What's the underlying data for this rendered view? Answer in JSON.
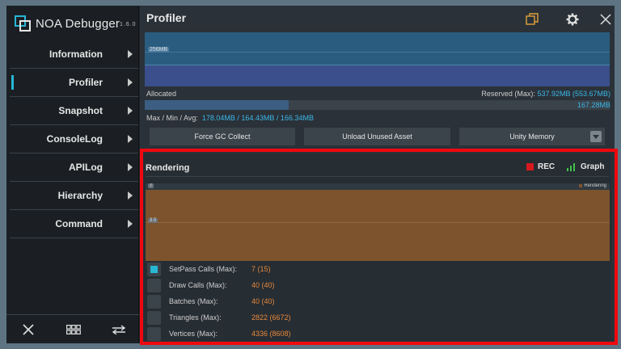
{
  "app": {
    "name": "NOA Debugger",
    "version": "1.6.0"
  },
  "sidebar": {
    "items": [
      {
        "label": "Information"
      },
      {
        "label": "Profiler"
      },
      {
        "label": "Snapshot"
      },
      {
        "label": "ConsoleLog"
      },
      {
        "label": "APILog"
      },
      {
        "label": "Hierarchy"
      },
      {
        "label": "Command"
      }
    ],
    "active_index": 1,
    "bottom_icons": [
      "close-icon",
      "grid-icon",
      "swap-icon"
    ]
  },
  "header": {
    "title": "Profiler",
    "icons": [
      "window-icon",
      "gear-icon",
      "close-icon"
    ]
  },
  "memory": {
    "chart_tick": "256MB",
    "allocated_label": "Allocated",
    "reserved_label": "Reserved (Max):",
    "reserved_value": "537.92MB (553.67MB)",
    "current_value": "167.28MB",
    "allocated_fraction": 0.31,
    "mma_label": "Max / Min / Avg:",
    "mma_value": "178.04MB / 164.43MB / 166.34MB"
  },
  "buttons": {
    "force_gc": "Force GC Collect",
    "unload_assets": "Unload Unused Asset",
    "dropdown": "Unity Memory"
  },
  "rendering": {
    "title": "Rendering",
    "rec_label": "REC",
    "graph_label": "Graph",
    "chart_tick_top": "7",
    "chart_tick_mid": "3.5",
    "legend": "Rendering",
    "stats": [
      {
        "label": "SetPass Calls (Max):",
        "value": "7 (15)",
        "checked": true
      },
      {
        "label": "Draw Calls (Max):",
        "value": "40 (40)",
        "checked": false
      },
      {
        "label": "Batches (Max):",
        "value": "40 (40)",
        "checked": false
      },
      {
        "label": "Triangles (Max):",
        "value": "2822 (6672)",
        "checked": false
      },
      {
        "label": "Vertices (Max):",
        "value": "4336 (8608)",
        "checked": false
      }
    ]
  },
  "colors": {
    "accent": "#27b7d4",
    "highlight": "#f0080f",
    "rec": "#d7191e",
    "graph": "#3fc34a",
    "stat_value": "#e8893c"
  }
}
